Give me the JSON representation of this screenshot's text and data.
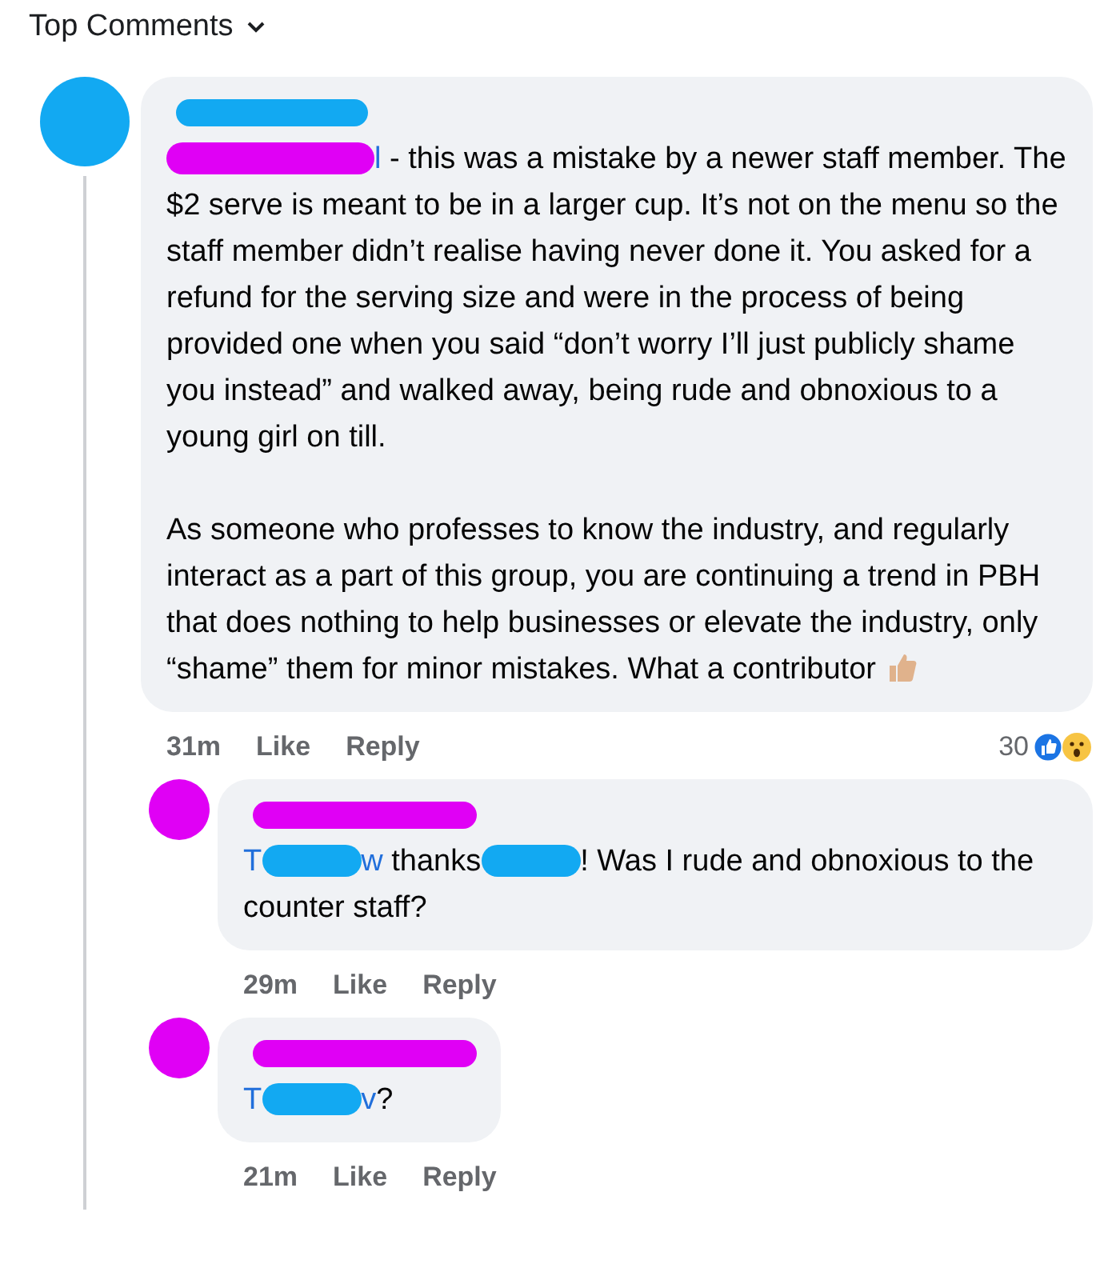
{
  "header": {
    "label": "Top Comments"
  },
  "comment": {
    "avatar_mark": {
      "color": "#12a9f2"
    },
    "name_mark": {
      "color": "#12a9f2"
    },
    "paragraphs": [
      [
        {
          "kind": "redacted",
          "color": "#e000f5"
        },
        {
          "kind": "mention",
          "text": "l"
        },
        {
          "kind": "text",
          "text": " - this was a mistake by a newer staff member. The $2 serve is meant to be in a larger cup. It’s not on the menu so the staff member didn’t realise having never done it. You asked for a refund for the serving size and were in the process of being provided one when you said “don’t worry I’ll just publicly shame you instead” and walked away, being rude and obnoxious to a young girl on till."
        }
      ],
      [
        {
          "kind": "text",
          "text": "As someone who professes to know the industry, and regularly interact as a part of this group, you are continuing a trend in PBH that does nothing to help businesses or elevate the industry, only “shame” them for minor mistakes. What a contributor "
        },
        {
          "kind": "emoji"
        }
      ]
    ],
    "time": "31m",
    "actions": [
      "Like",
      "Reply"
    ],
    "reactions": {
      "count": "30"
    },
    "replies": [
      {
        "avatar_mark": {
          "color": "#e000f5"
        },
        "name_mark": {
          "color": "#e000f5"
        },
        "paragraphs": [
          [
            {
              "kind": "mention",
              "text": "T"
            },
            {
              "kind": "redacted",
              "color": "#12a9f2"
            },
            {
              "kind": "mention",
              "text": "w"
            },
            {
              "kind": "text",
              "text": " thanks"
            },
            {
              "kind": "redacted",
              "color": "#12a9f2"
            },
            {
              "kind": "text",
              "text": "! Was I rude and obnoxious to the counter staff?"
            }
          ]
        ],
        "time": "29m",
        "actions": [
          "Like",
          "Reply"
        ]
      },
      {
        "avatar_mark": {
          "color": "#e000f5"
        },
        "name_mark": {
          "color": "#e000f5"
        },
        "paragraphs": [
          [
            {
              "kind": "mention",
              "text": "T"
            },
            {
              "kind": "redacted",
              "color": "#12a9f2"
            },
            {
              "kind": "mention",
              "text": "v"
            },
            {
              "kind": "text",
              "text": "?"
            }
          ]
        ],
        "time": "21m",
        "actions": [
          "Like",
          "Reply"
        ]
      }
    ]
  }
}
